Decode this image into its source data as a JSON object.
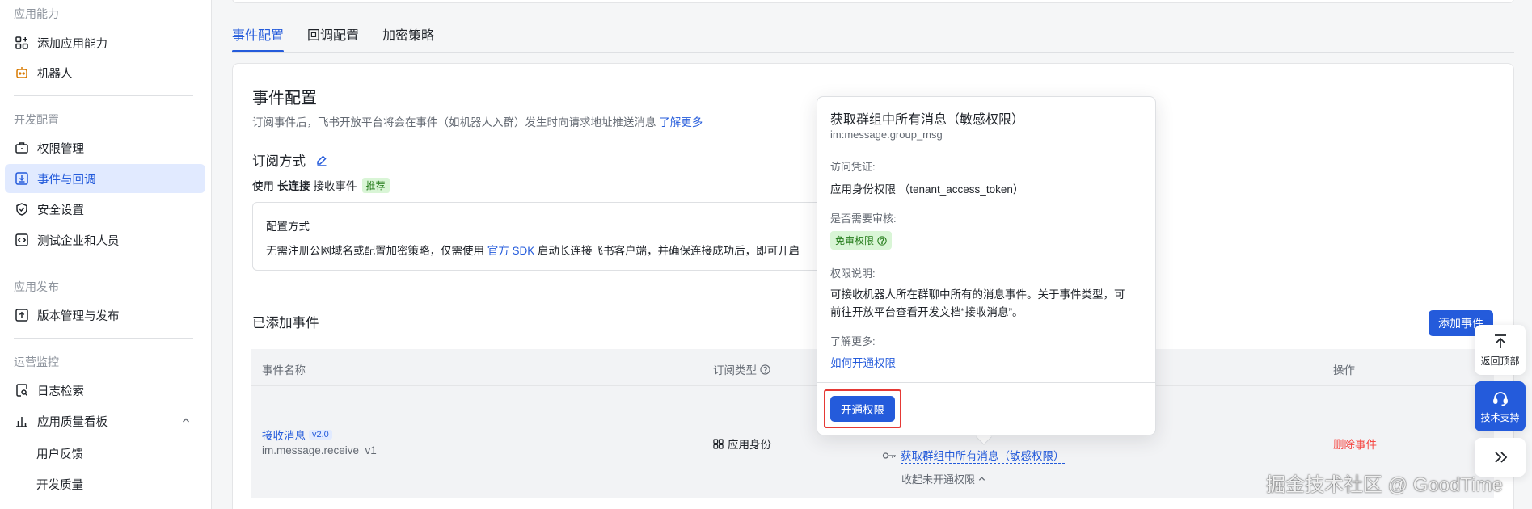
{
  "sidebar": {
    "groups": {
      "app_ability": "应用能力",
      "dev_config": "开发配置",
      "app_release": "应用发布",
      "ops_monitor": "运营监控"
    },
    "items": {
      "add_ability": "添加应用能力",
      "robot": "机器人",
      "permissions": "权限管理",
      "events": "事件与回调",
      "security": "安全设置",
      "test_org": "测试企业和人员",
      "versions": "版本管理与发布",
      "logs": "日志检索",
      "quality_board": "应用质量看板",
      "feedback": "用户反馈",
      "dev_quality": "开发质量"
    }
  },
  "tabs": [
    "事件配置",
    "回调配置",
    "加密策略"
  ],
  "event_config": {
    "title": "事件配置",
    "description": "订阅事件后，飞书开放平台将会在事件（如机器人入群）发生时向请求地址推送消息",
    "learn_more": "了解更多",
    "subscribe_title": "订阅方式",
    "subscribe_prefix": "使用",
    "subscribe_bold": "长连接",
    "subscribe_suffix": "接收事件",
    "recommend_tag": "推荐",
    "config_box_title": "配置方式",
    "config_text_before": "无需注册公网域名或配置加密策略，仅需使用",
    "config_link": "官方 SDK",
    "config_text_after": "启动长连接飞书客户端，并确保连接成功后，即可开启"
  },
  "added_events": {
    "title": "已添加事件",
    "add_button": "添加事件",
    "columns": {
      "name": "事件名称",
      "sub_type": "订阅类型",
      "action": "操作"
    },
    "rows": [
      {
        "name": "接收消息",
        "version": "v2.0",
        "code": "im.message.receive_v1",
        "sub_type": "应用身份",
        "permission": "获取群组中所有消息（敏感权限）",
        "action": "删除事件",
        "collapse": "收起未开通权限"
      }
    ]
  },
  "popover": {
    "title": "获取群组中所有消息（敏感权限）",
    "scope": "im:message.group_msg",
    "credential_label": "访问凭证:",
    "credential_value": "应用身份权限 （tenant_access_token）",
    "review_label": "是否需要审核:",
    "review_tag": "免审权限",
    "desc_label": "权限说明:",
    "desc_line1": "可接收机器人所在群聊中所有的消息事件。关于事件类型，可",
    "desc_line2": "前往开放平台查看开发文档“接收消息”。",
    "learn_label": "了解更多:",
    "learn_link": "如何开通权限",
    "enable_button": "开通权限"
  },
  "floating": {
    "back_top": "返回顶部",
    "support": "技术支持"
  },
  "watermark": "掘金技术社区 @ GoodTime",
  "colors": {
    "primary": "#245bdb",
    "danger": "#f54a45",
    "success_bg": "#d9f5d6",
    "highlight": "#e53935"
  }
}
